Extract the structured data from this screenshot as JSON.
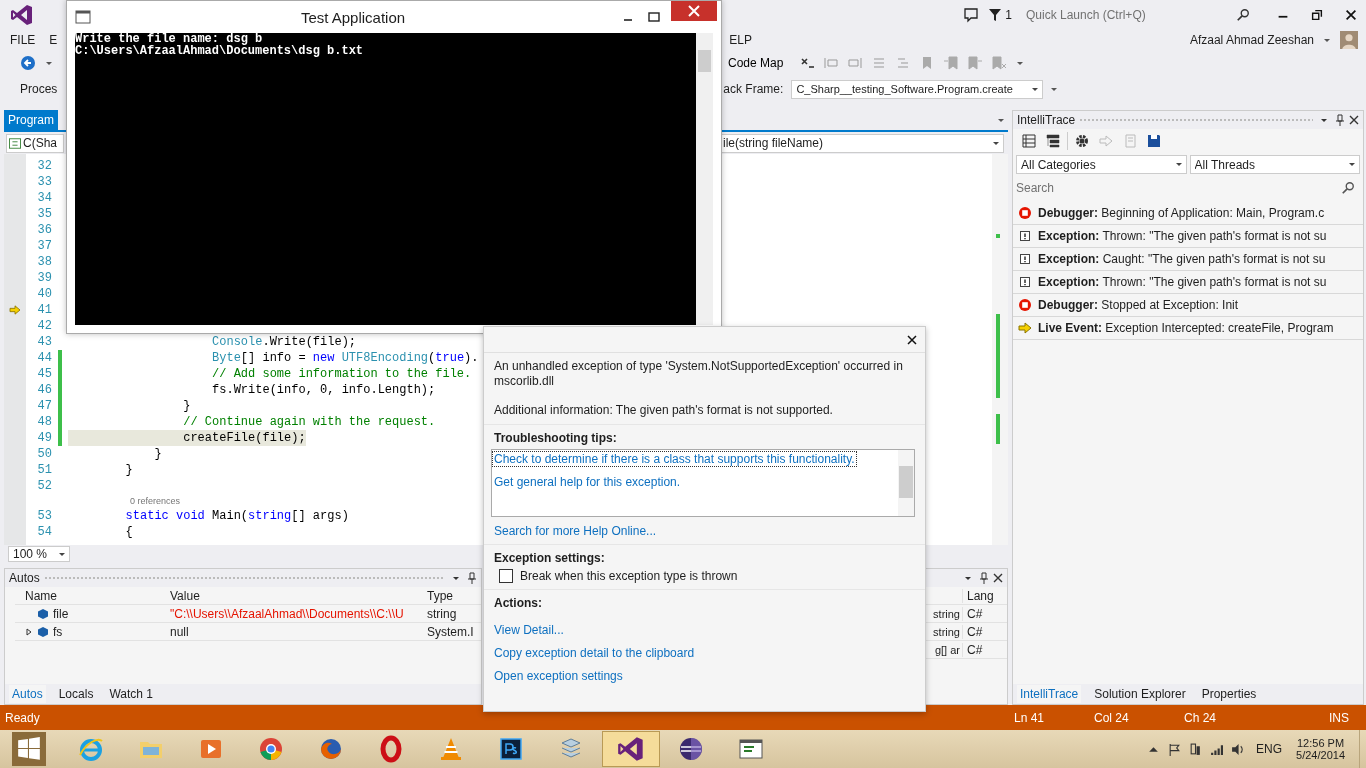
{
  "window": {
    "notifications_count": "1",
    "quick_launch_placeholder": "Quick Launch (Ctrl+Q)",
    "user": "Afzaal Ahmad Zeeshan"
  },
  "menu_left": [
    {
      "label": "FILE"
    },
    {
      "label": "E"
    }
  ],
  "menu_right": [
    {
      "label": "ELP"
    }
  ],
  "toolbar": {
    "code_map": "Code Map",
    "process_label": "Proces",
    "stack_frame_label": "ack Frame:",
    "stack_frame_value": "C_Sharp__testing_Software.Program.create"
  },
  "editor": {
    "tab": "Program",
    "type_dropdown": "C(Sha",
    "member_dropdown": "ile(string fileName)",
    "zoom": "100 %",
    "lines": [
      {
        "kind": "code",
        "number": "32",
        "current": false,
        "changed": false,
        "highlighted": false
      },
      {
        "kind": "code",
        "number": "33",
        "current": false,
        "changed": false,
        "highlighted": false
      },
      {
        "kind": "code",
        "number": "34",
        "current": false,
        "changed": false,
        "highlighted": false
      },
      {
        "kind": "code",
        "number": "35",
        "current": false,
        "changed": false,
        "highlighted": false
      },
      {
        "kind": "code",
        "number": "36",
        "current": false,
        "changed": false,
        "highlighted": false
      },
      {
        "kind": "code",
        "number": "37",
        "current": false,
        "changed": false,
        "highlighted": false
      },
      {
        "kind": "code",
        "number": "38",
        "current": false,
        "changed": false,
        "highlighted": false
      },
      {
        "kind": "code",
        "number": "39",
        "current": false,
        "changed": false,
        "highlighted": false
      },
      {
        "kind": "code",
        "number": "40",
        "current": false,
        "changed": false,
        "highlighted": false
      },
      {
        "kind": "code",
        "number": "41",
        "current": true,
        "changed": false,
        "highlighted": false
      },
      {
        "kind": "code",
        "number": "42",
        "current": false,
        "changed": false,
        "highlighted": false
      },
      {
        "kind": "code",
        "number": "43",
        "current": false,
        "changed": false,
        "highlighted": false,
        "tokens": [
          {
            "kind": "type",
            "text": "                    Console"
          },
          {
            "kind": "plain",
            "text": ".Write(file);"
          }
        ]
      },
      {
        "kind": "code",
        "number": "44",
        "current": false,
        "changed": true,
        "highlighted": false,
        "tokens": [
          {
            "kind": "type",
            "text": "                    Byte"
          },
          {
            "kind": "plain",
            "text": "[] info = "
          },
          {
            "kind": "keyword",
            "text": "new "
          },
          {
            "kind": "type",
            "text": "UTF8Encoding"
          },
          {
            "kind": "plain",
            "text": "("
          },
          {
            "kind": "keyword",
            "text": "true"
          },
          {
            "kind": "plain",
            "text": ")."
          }
        ]
      },
      {
        "kind": "code",
        "number": "45",
        "current": false,
        "changed": true,
        "highlighted": false,
        "tokens": [
          {
            "kind": "comment",
            "text": "                    // Add some information to the file."
          }
        ]
      },
      {
        "kind": "code",
        "number": "46",
        "current": false,
        "changed": true,
        "highlighted": false,
        "tokens": [
          {
            "kind": "plain",
            "text": "                    fs.Write(info, 0, info.Length);"
          }
        ]
      },
      {
        "kind": "code",
        "number": "47",
        "current": false,
        "changed": true,
        "highlighted": false,
        "tokens": [
          {
            "kind": "plain",
            "text": "                }"
          }
        ]
      },
      {
        "kind": "code",
        "number": "48",
        "current": false,
        "changed": true,
        "highlighted": false,
        "tokens": [
          {
            "kind": "comment",
            "text": "                // Continue again with the request."
          }
        ]
      },
      {
        "kind": "code",
        "number": "49",
        "current": false,
        "changed": true,
        "highlighted": true,
        "tokens": [
          {
            "kind": "plain",
            "text": "                createFile(file);"
          }
        ]
      },
      {
        "kind": "code",
        "number": "50",
        "current": false,
        "changed": false,
        "highlighted": false,
        "tokens": [
          {
            "kind": "plain",
            "text": "            }"
          }
        ]
      },
      {
        "kind": "code",
        "number": "51",
        "current": false,
        "changed": false,
        "highlighted": false,
        "tokens": [
          {
            "kind": "plain",
            "text": "        }"
          }
        ]
      },
      {
        "kind": "code",
        "number": "52",
        "current": false,
        "changed": false,
        "highlighted": false
      },
      {
        "kind": "codelens",
        "text": "0 references"
      },
      {
        "kind": "code",
        "number": "53",
        "current": false,
        "changed": false,
        "highlighted": false,
        "tokens": [
          {
            "kind": "keyword",
            "text": "        static void"
          },
          {
            "kind": "plain",
            "text": " Main("
          },
          {
            "kind": "keyword",
            "text": "string"
          },
          {
            "kind": "plain",
            "text": "[] args)"
          }
        ]
      },
      {
        "kind": "code",
        "number": "54",
        "current": false,
        "changed": false,
        "highlighted": false,
        "tokens": [
          {
            "kind": "plain",
            "text": "        {"
          }
        ]
      }
    ]
  },
  "console": {
    "title": "Test Application",
    "lines": [
      "Write the file name: dsg b",
      "C:\\Users\\AfzaalAhmad\\Documents\\dsg b.txt"
    ]
  },
  "exception": {
    "message": "An unhandled exception of type 'System.NotSupportedException' occurred in mscorlib.dll",
    "additional": "Additional information: The given path's format is not supported.",
    "tips_heading": "Troubleshooting tips:",
    "tips": [
      {
        "text": "Check to determine if there is a class that supports this functionality.",
        "selected": true
      },
      {
        "text": "Get general help for this exception.",
        "selected": false
      }
    ],
    "search_link": "Search for more Help Online...",
    "settings_heading": "Exception settings:",
    "break_option": {
      "label": "Break when this exception type is thrown",
      "checked": false
    },
    "actions_heading": "Actions:",
    "actions": [
      "View Detail...",
      "Copy exception detail to the clipboard",
      "Open exception settings"
    ]
  },
  "autos": {
    "title": "Autos",
    "columns": [
      "Name",
      "Value",
      "Type"
    ],
    "rows": [
      {
        "name": "file",
        "value": "\"C:\\\\Users\\\\AfzaalAhmad\\\\Documents\\\\C:\\\\U",
        "type": "string",
        "expandable": false,
        "changed": true
      },
      {
        "name": "fs",
        "value": "null",
        "type": "System.I",
        "expandable": true,
        "changed": false
      }
    ],
    "tabs": [
      {
        "label": "Autos",
        "selected": true
      },
      {
        "label": "Locals",
        "selected": false
      },
      {
        "label": "Watch 1",
        "selected": false
      }
    ]
  },
  "call_stack": {
    "columns": [
      "Lang"
    ],
    "rows": [
      {
        "column_1": "string",
        "lang": "C#"
      },
      {
        "column_1": "string",
        "lang": "C#"
      },
      {
        "column_1": "g[] ar",
        "lang": "C#"
      }
    ]
  },
  "intellitrace": {
    "title": "IntelliTrace",
    "categories": "All Categories",
    "threads": "All Threads",
    "search_placeholder": "Search",
    "events": [
      {
        "kind": "debugger",
        "category": "Debugger:",
        "text": "Beginning of Application: Main, Program.c"
      },
      {
        "kind": "exception",
        "category": "Exception:",
        "text": "Thrown: \"The given path's format is not su"
      },
      {
        "kind": "exception",
        "category": "Exception:",
        "text": "Caught: \"The given path's format is not su"
      },
      {
        "kind": "exception",
        "category": "Exception:",
        "text": "Thrown: \"The given path's format is not su"
      },
      {
        "kind": "debugger",
        "category": "Debugger:",
        "text": "Stopped at Exception: Init"
      },
      {
        "kind": "live",
        "category": "Live Event:",
        "text": "Exception Intercepted: createFile, Program"
      }
    ],
    "tabs": [
      {
        "label": "IntelliTrace",
        "selected": true
      },
      {
        "label": "Solution Explorer",
        "selected": false
      },
      {
        "label": "Properties",
        "selected": false
      }
    ]
  },
  "status_bar": {
    "state": "Ready",
    "line": "Ln 41",
    "column": "Col 24",
    "char": "Ch 24",
    "mode": "INS"
  },
  "taskbar": {
    "apps": [
      {
        "kind": "ie",
        "selected": false
      },
      {
        "kind": "explorer",
        "selected": false
      },
      {
        "kind": "media",
        "selected": false
      },
      {
        "kind": "chrome",
        "selected": false
      },
      {
        "kind": "firefox",
        "selected": false
      },
      {
        "kind": "opera",
        "selected": false
      },
      {
        "kind": "vlc",
        "selected": false
      },
      {
        "kind": "photoshop",
        "selected": false
      },
      {
        "kind": "stack",
        "selected": false
      },
      {
        "kind": "vs",
        "selected": true
      },
      {
        "kind": "eclipse",
        "selected": false
      },
      {
        "kind": "console",
        "selected": false
      }
    ],
    "language": "ENG",
    "time": "12:56 PM",
    "date": "5/24/2014"
  }
}
